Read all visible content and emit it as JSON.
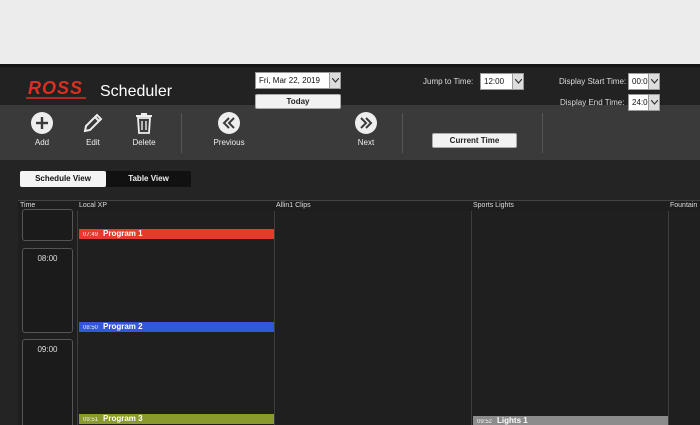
{
  "header": {
    "logo_text": "ROSS",
    "title": "Scheduler"
  },
  "toolbar": {
    "add_label": "Add",
    "edit_label": "Edit",
    "delete_label": "Delete",
    "previous_label": "Previous",
    "next_label": "Next",
    "date_value": "Fri, Mar 22, 2019",
    "today_label": "Today",
    "jump_label": "Jump to Time:",
    "jump_value": "12:00",
    "current_time_label": "Current Time",
    "start_label": "Display Start Time:",
    "start_value": "00:00",
    "end_label": "Display End Time:",
    "end_value": "24:00"
  },
  "tabs": {
    "schedule": "Schedule View",
    "table": "Table View"
  },
  "grid": {
    "columns": [
      "Time",
      "Local XP",
      "Allin1 Clips",
      "Sports Lights",
      "Fountain"
    ],
    "times": [
      "",
      "08:00",
      "09:00"
    ]
  },
  "events": [
    {
      "time": "07:49",
      "name": "Program 1",
      "color": "#e53a2c"
    },
    {
      "time": "08:50",
      "name": "Program 2",
      "color": "#3158d6"
    },
    {
      "time": "09:51",
      "name": "Program 3",
      "color": "#8a9a2c"
    },
    {
      "time": "09:52",
      "name": "Lights 1",
      "color": "#8c8c8c"
    }
  ],
  "colors": {
    "accent_red": "#d9301f",
    "toolbar_bg": "#3a3a3a",
    "app_bg": "#242424"
  }
}
